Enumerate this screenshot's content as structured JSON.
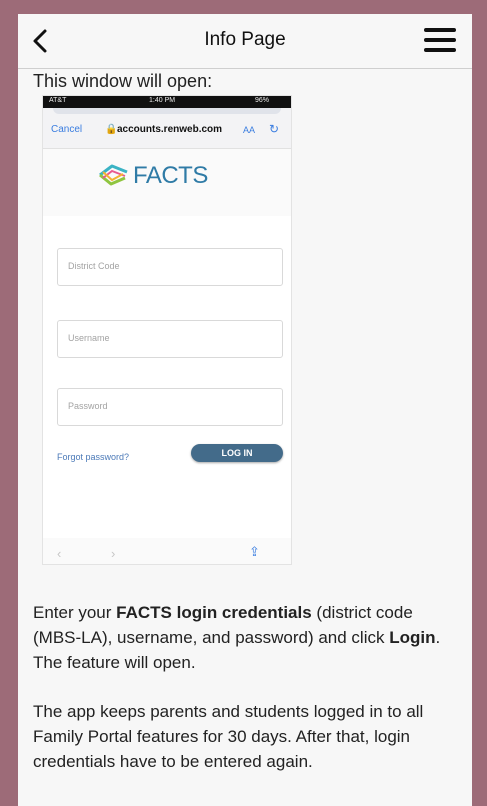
{
  "header": {
    "title": "Info Page",
    "back_icon": "chevron-left-icon",
    "menu_icon": "hamburger-menu-icon"
  },
  "content": {
    "intro": "This window will open:",
    "screenshot": {
      "statusbar": {
        "carrier": "AT&T",
        "time": "1:40 PM",
        "battery": "96%"
      },
      "cancel_label": "Cancel",
      "domain": "accounts.renweb.com",
      "text_size_label": "AA",
      "logo_text": "FACTS",
      "district_placeholder": "District Code",
      "username_placeholder": "Username",
      "password_placeholder": "Password",
      "forgot_label": "Forgot password?",
      "login_label": "LOG IN"
    },
    "paragraph1": {
      "t1": "Enter your ",
      "t2": "FACTS login credentials",
      "t3": " (district code (MBS-LA), username, and password) and click ",
      "t4": "Login",
      "t5": ".",
      "t6": "The feature will open."
    },
    "paragraph2": "The app keeps parents and students logged in to all Family Portal features for 30 days. After that, login credentials have to be entered again."
  },
  "colors": {
    "background": "#9d6b78",
    "link": "#3a7de0",
    "button": "#436b8a"
  }
}
